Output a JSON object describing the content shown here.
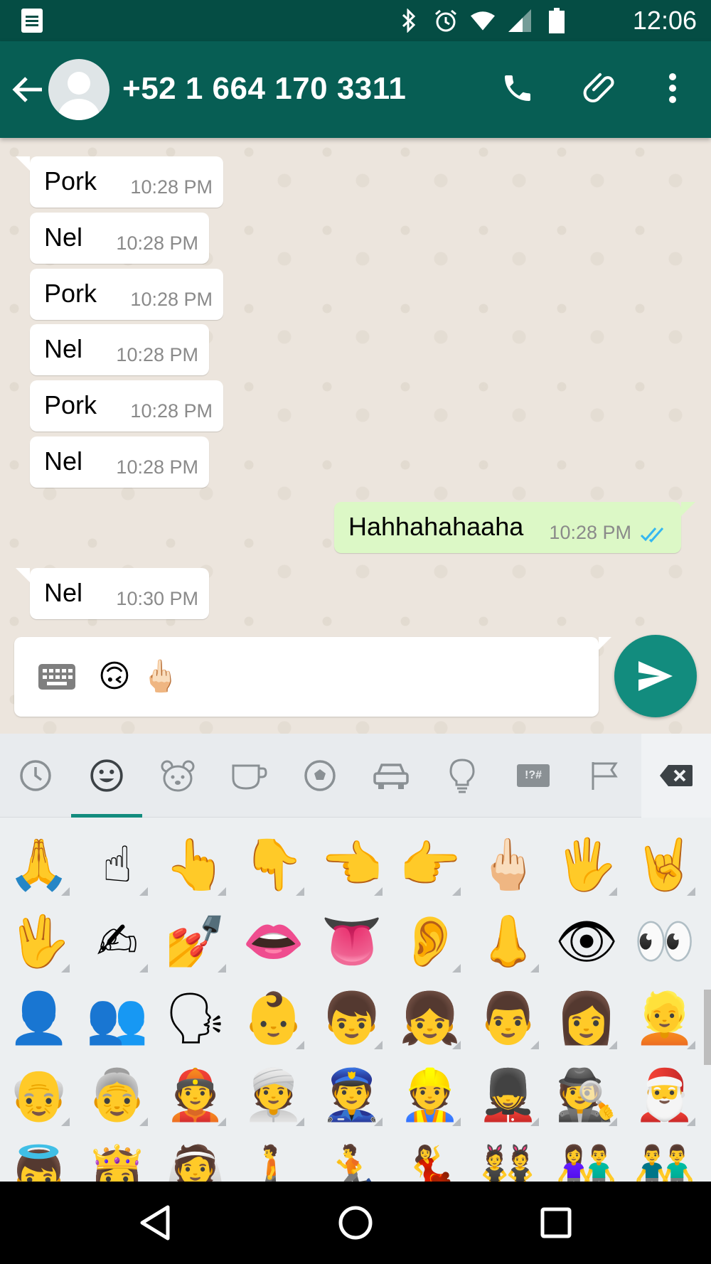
{
  "status_bar": {
    "time": "12:06",
    "icons": [
      "notes-icon",
      "bluetooth-icon",
      "alarm-icon",
      "wifi-icon",
      "signal-icon",
      "battery-icon"
    ]
  },
  "app_bar": {
    "contact_name": "+52 1 664 170 3311",
    "icons": [
      "back-arrow-icon",
      "avatar-placeholder-icon",
      "phone-icon",
      "paperclip-icon",
      "more-vert-icon"
    ]
  },
  "messages": [
    {
      "direction": "in",
      "text": "Pork",
      "time": "10:28 PM"
    },
    {
      "direction": "in",
      "text": "Nel",
      "time": "10:28 PM"
    },
    {
      "direction": "in",
      "text": "Pork",
      "time": "10:28 PM"
    },
    {
      "direction": "in",
      "text": "Nel",
      "time": "10:28 PM"
    },
    {
      "direction": "in",
      "text": "Pork",
      "time": "10:28 PM"
    },
    {
      "direction": "in",
      "text": "Nel",
      "time": "10:28 PM"
    },
    {
      "direction": "out",
      "text": "Hahhahahaaha",
      "time": "10:28 PM",
      "status": "read"
    },
    {
      "direction": "in",
      "text": "Nel",
      "time": "10:30 PM"
    }
  ],
  "composer": {
    "emojis": [
      "🙃",
      "🖕🏻"
    ],
    "icons": [
      "keyboard-icon",
      "send-icon"
    ]
  },
  "emoji_keyboard": {
    "tabs": [
      "recent-tab",
      "smileys-tab",
      "animals-tab",
      "food-tab",
      "activity-tab",
      "travel-tab",
      "objects-tab",
      "symbols-tab",
      "flags-tab"
    ],
    "active_tab": "smileys-tab",
    "symbols_tab_label": "!?#",
    "rows": [
      [
        "🙏",
        "☝",
        "👆",
        "👇",
        "👈",
        "👉",
        "🖕🏻",
        "🖐",
        "🤘"
      ],
      [
        "🖖",
        "✍",
        "💅",
        "👄",
        "👅",
        "👂",
        "👃",
        "👁",
        "👀"
      ],
      [
        "👤",
        "👥",
        "🗣",
        "👶",
        "👦",
        "👧",
        "👨",
        "👩",
        "👱"
      ],
      [
        "👴",
        "👵",
        "👲",
        "👳",
        "👮",
        "👷",
        "💂",
        "🕵",
        "🎅"
      ],
      [
        "👼",
        "👸",
        "👰",
        "🚶",
        "🏃",
        "💃",
        "👯",
        "👫",
        "👬"
      ]
    ],
    "accent_color": "#128c7e"
  },
  "nav_bar": {
    "icons": [
      "back-triangle-icon",
      "home-circle-icon",
      "recents-square-icon"
    ]
  },
  "colors": {
    "header": "#075e54",
    "status_bar": "#054d44",
    "outgoing_bubble": "#dcf8c6",
    "incoming_bubble": "#ffffff",
    "chat_bg": "#ece5dd",
    "send_button": "#128c7e",
    "read_ticks": "#34b7f1"
  }
}
